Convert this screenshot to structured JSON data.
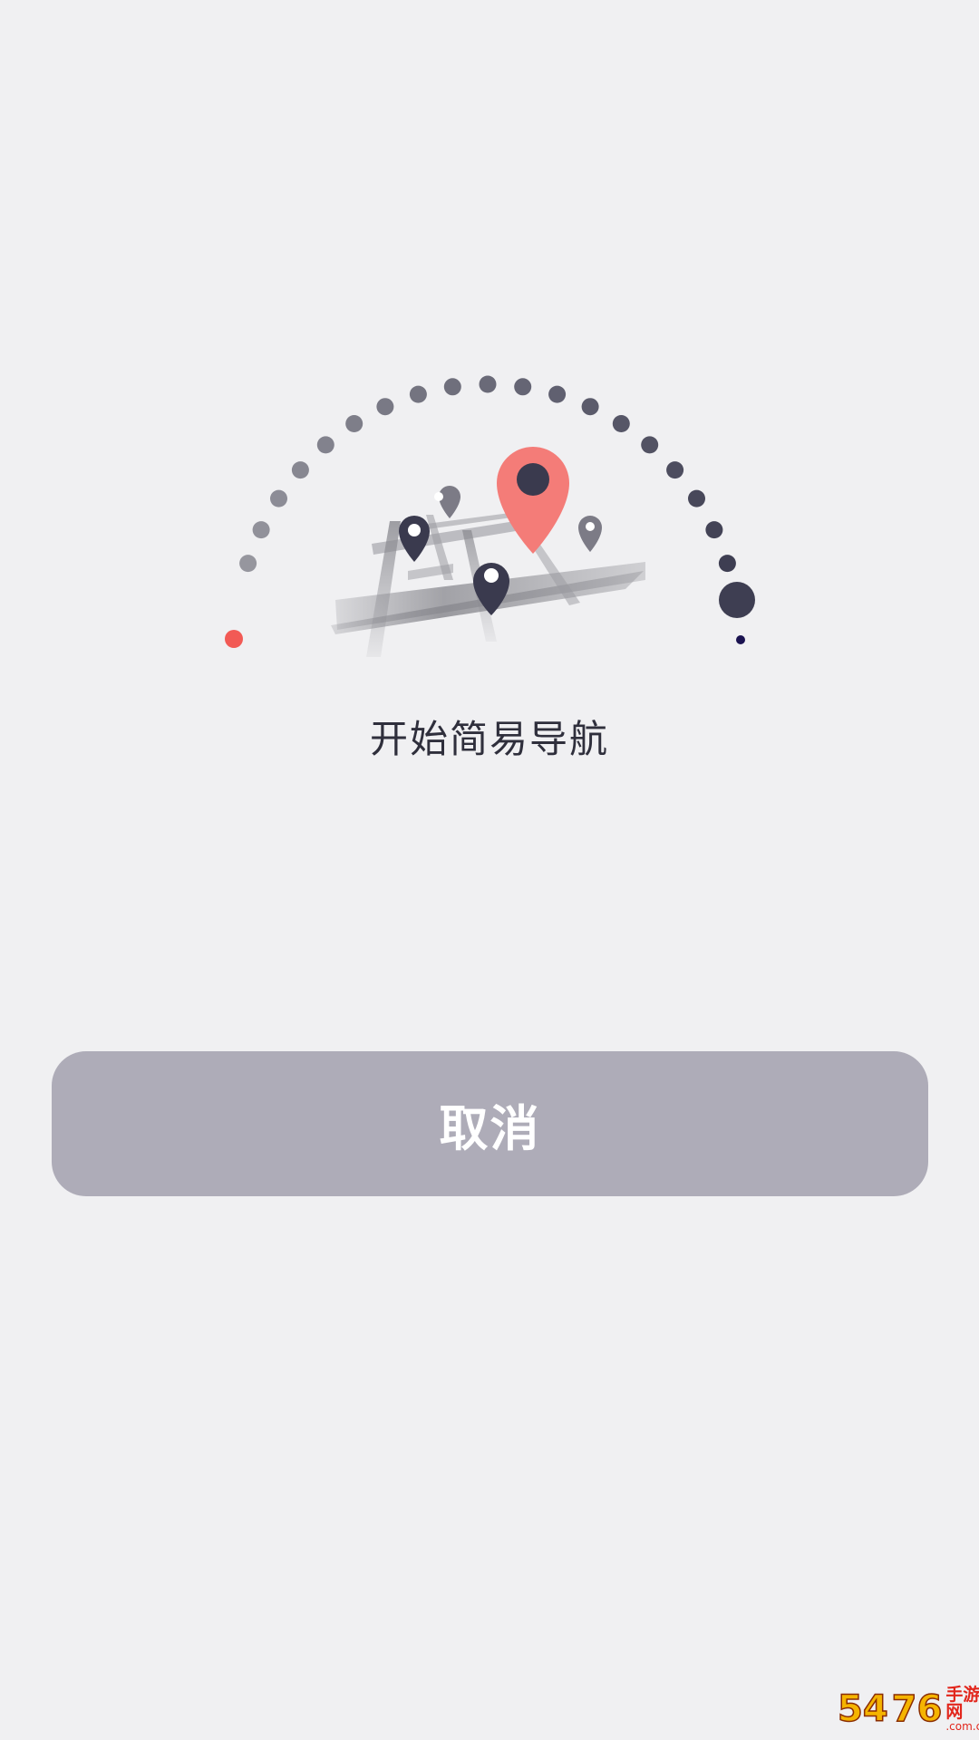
{
  "main": {
    "title": "开始简易导航",
    "cancel_label": "取消"
  },
  "illustration": {
    "icons": [
      "map-pin-icon",
      "road-map-icon",
      "progress-dots"
    ],
    "colors": {
      "accent": "#f47c78",
      "pin_dark": "#3a3a4e",
      "pin_gray": "#7c7b86",
      "start_dot": "#f25a55",
      "end_dot": "#1a1250"
    }
  },
  "watermark": {
    "number": "54",
    "number_tail": "76",
    "name": "手游网",
    "domain": ".com.cn"
  },
  "colors": {
    "background": "#f0f0f2",
    "button_bg": "#aeacb8",
    "button_text": "#ffffff",
    "title_text": "#2f2f3c"
  }
}
